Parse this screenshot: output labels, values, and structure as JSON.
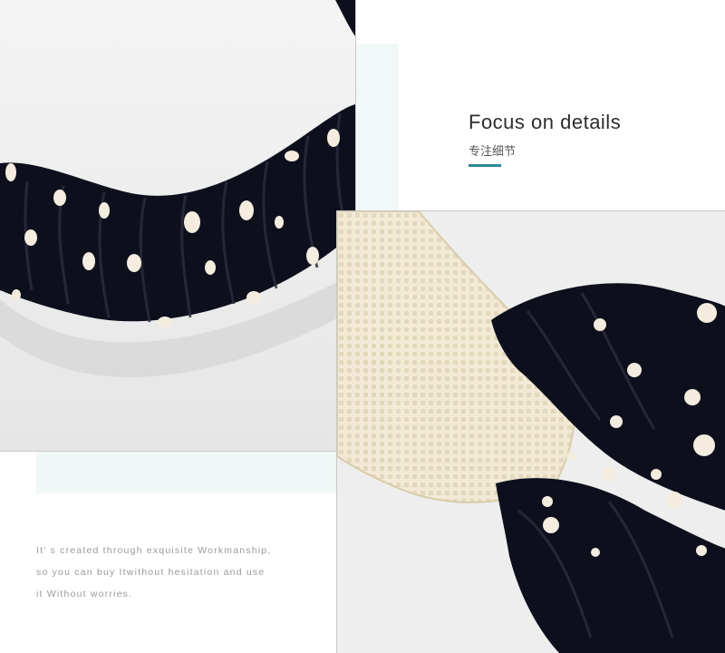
{
  "heading": {
    "title": "Focus on details",
    "subtitle": "专注细节"
  },
  "description": {
    "lines": [
      "It' s created through exquisite Workmanship,",
      "so you can buy Itwithout hesitation and use",
      "it Without worries."
    ]
  },
  "colors": {
    "accent": "#2a8a96",
    "fabric": "#0d0f1c",
    "dots": "#f3ecdf",
    "lace": "#f2ead6",
    "tint": "#f0f7f6"
  },
  "images": [
    {
      "name": "photo-headband-scrunched",
      "depicts": "close-up of black polka-dot headband fabric"
    },
    {
      "name": "photo-lace-knot",
      "depicts": "cream lace twisted with black polka-dot fabric"
    }
  ]
}
